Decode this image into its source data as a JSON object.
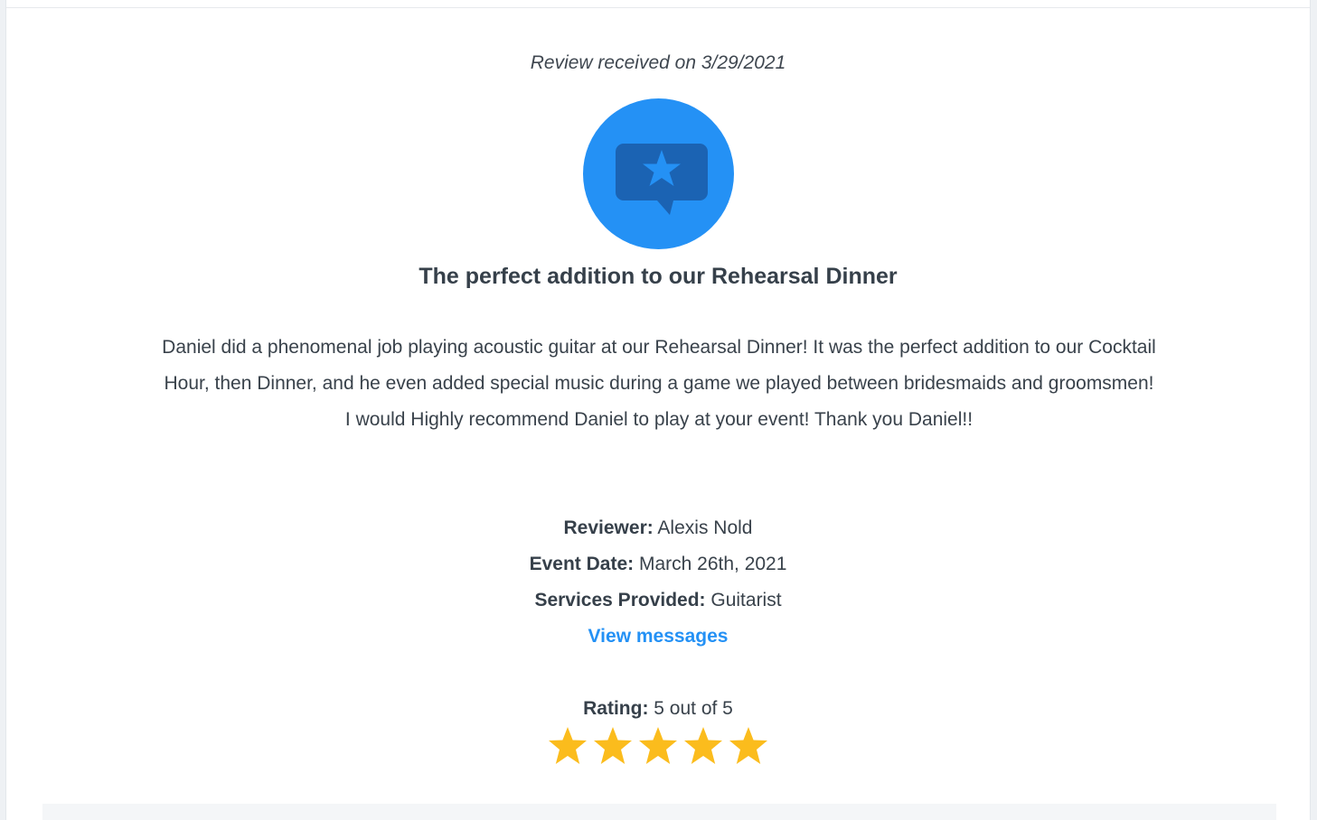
{
  "review": {
    "received_text": "Review received on 3/29/2021",
    "badge_icon": "speech-bubble-star-icon",
    "title": "The perfect addition to our Rehearsal Dinner",
    "body_paragraph_1": "Daniel did a phenomenal job playing acoustic guitar at our Rehearsal Dinner! It was the perfect addition to our Cocktail Hour, then Dinner, and he even added special music during a game we played between bridesmaids and groomsmen!",
    "body_paragraph_2": "I would Highly recommend Daniel to play at your event! Thank you Daniel!!",
    "reviewer_label": "Reviewer:",
    "reviewer_value": "Alexis Nold",
    "event_date_label": "Event Date:",
    "event_date_value": "March 26th, 2021",
    "services_label": "Services Provided:",
    "services_value": "Guitarist",
    "view_messages_label": "View messages",
    "rating_label": "Rating:",
    "rating_text": "5 out of 5",
    "rating_value": 5,
    "rating_max": 5
  },
  "colors": {
    "accent": "#2491f5",
    "badge_bubble": "#1b63b3",
    "star": "#fbbc1d",
    "text": "#39424b"
  }
}
